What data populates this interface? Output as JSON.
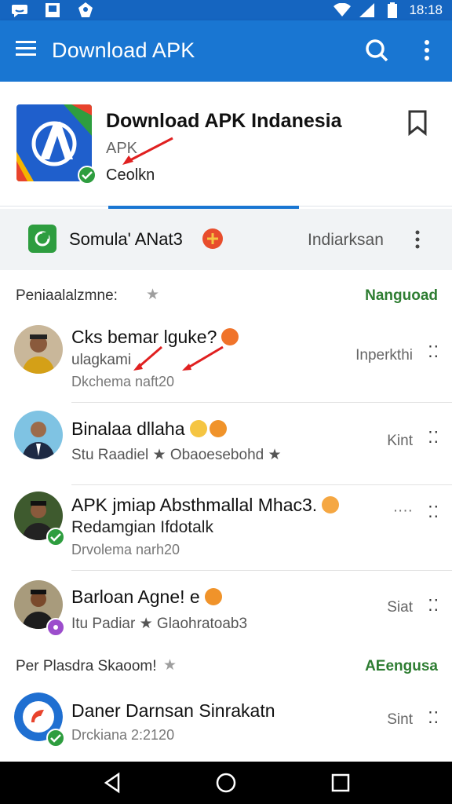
{
  "status_bar": {
    "time": "18:18"
  },
  "app_bar": {
    "title": "Download APK"
  },
  "app_header": {
    "title": "Download APK Indanesia",
    "subtitle": "APK",
    "status": "Ceolkn"
  },
  "sub_bar": {
    "name": "Somula' ANat3",
    "right_label": "Indiarksan"
  },
  "sections": [
    {
      "label": "Peniaalalzmne:",
      "action": "Nanguoad"
    },
    {
      "label": "Per Plasdra Skaoom!",
      "action": "AEengusa"
    }
  ],
  "rows": [
    {
      "title": "Cks bemar lguke?",
      "line2": "ulagkami",
      "line3": "Dkchema naft20",
      "meta": "Inperkthi",
      "dots": "⁚⁚"
    },
    {
      "title": "Binalaa dllaha",
      "line2": "Stu Raadiel ★ Obaoesebohd ★",
      "meta": "Kint",
      "dots": "⁚⁚"
    },
    {
      "title": "APK jmiap Absthmallal Mhac3.",
      "line2": "Redamgian Ifdotalk",
      "line3": "Drvolema narh20",
      "meta": "····",
      "dots": "⁚⁚"
    },
    {
      "title": "Barloan Agne! e",
      "line2": "Itu Padiar ★ Glaohratoab3",
      "meta": "Siat",
      "dots": "⁚⁚"
    },
    {
      "title": "Daner Darnsan Sinrakatn",
      "line3": "Drckiana 2:2120",
      "meta": "Sint",
      "dots": "⁚⁚"
    }
  ],
  "colors": {
    "primary": "#1976d2",
    "status": "#1565c0",
    "accent_green": "#2e7d32",
    "verify": "#2e9d3f"
  }
}
